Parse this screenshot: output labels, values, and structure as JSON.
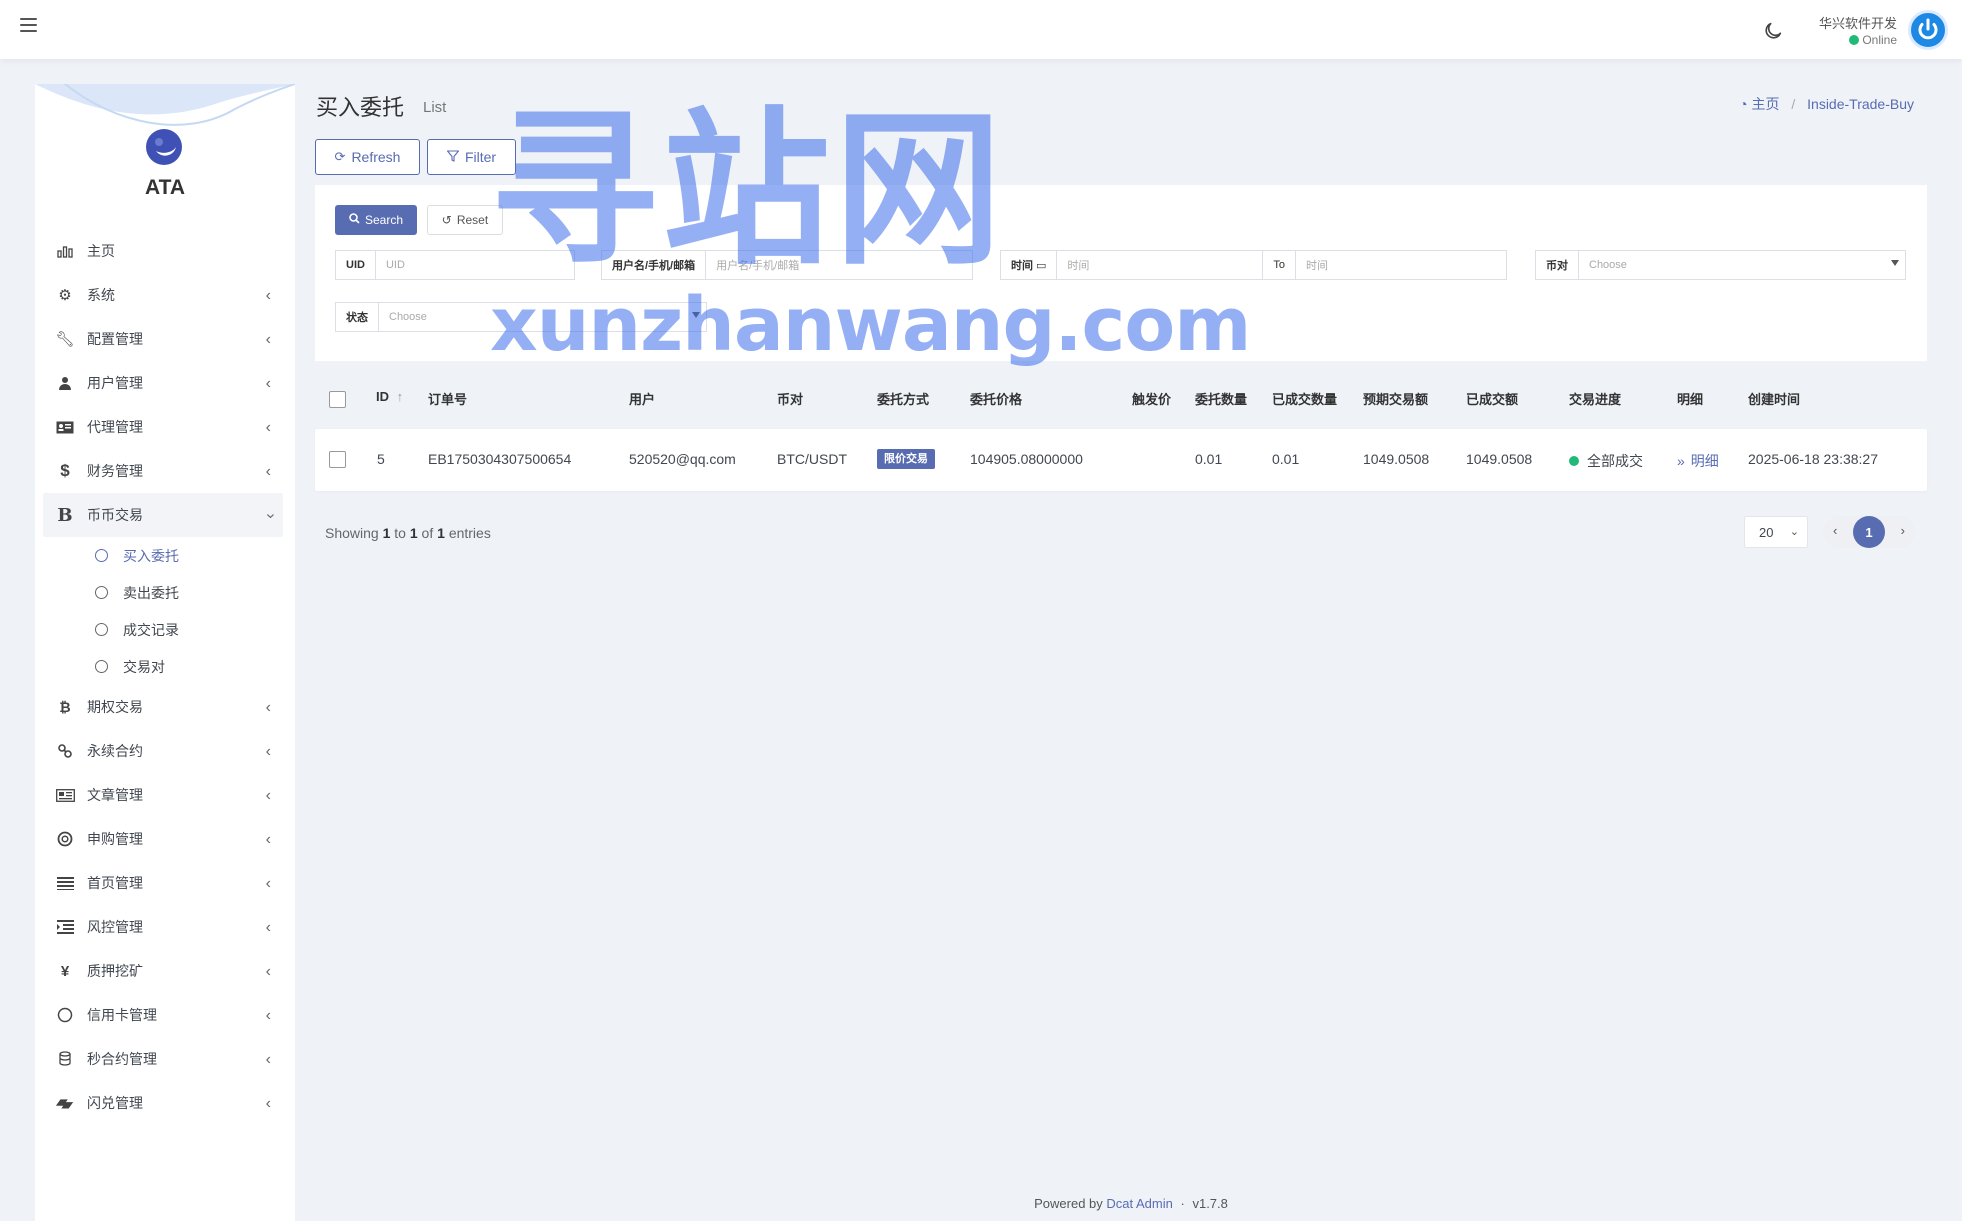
{
  "header": {
    "user_name": "华兴软件开发",
    "user_status": "Online"
  },
  "sidebar": {
    "brand": "ATA",
    "items": [
      {
        "label": "主页",
        "icon": "bar-chart-icon"
      },
      {
        "label": "系统",
        "icon": "gear-icon"
      },
      {
        "label": "配置管理",
        "icon": "wrench-icon"
      },
      {
        "label": "用户管理",
        "icon": "users-icon"
      },
      {
        "label": "代理管理",
        "icon": "id-card-icon"
      },
      {
        "label": "财务管理",
        "icon": "dollar-icon"
      },
      {
        "label": "币币交易",
        "icon": "bitcoin-b-icon"
      },
      {
        "label": "期权交易",
        "icon": "bitcoin-icon"
      },
      {
        "label": "永续合约",
        "icon": "link-icon"
      },
      {
        "label": "文章管理",
        "icon": "newspaper-icon"
      },
      {
        "label": "申购管理",
        "icon": "lifebuoy-icon"
      },
      {
        "label": "首页管理",
        "icon": "list-icon"
      },
      {
        "label": "风控管理",
        "icon": "indent-icon"
      },
      {
        "label": "质押挖矿",
        "icon": "yen-icon"
      },
      {
        "label": "信用卡管理",
        "icon": "circle-icon"
      },
      {
        "label": "秒合约管理",
        "icon": "coins-icon"
      },
      {
        "label": "闪兑管理",
        "icon": "exchange-icon"
      }
    ],
    "submenu": [
      {
        "label": "买入委托"
      },
      {
        "label": "卖出委托"
      },
      {
        "label": "成交记录"
      },
      {
        "label": "交易对"
      }
    ]
  },
  "page": {
    "title": "买入委托",
    "subtitle": "List",
    "breadcrumb_home": "主页",
    "breadcrumb_current": "Inside-Trade-Buy"
  },
  "toolbar": {
    "refresh_label": "Refresh",
    "filter_label": "Filter"
  },
  "filter": {
    "search_label": "Search",
    "reset_label": "Reset",
    "uid_label": "UID",
    "uid_placeholder": "UID",
    "user_label": "用户名/手机/邮箱",
    "user_placeholder": "用户名/手机/邮箱",
    "time_label": "时间",
    "time_placeholder": "时间",
    "to_label": "To",
    "to_placeholder": "时间",
    "pair_label": "币对",
    "pair_value": "Choose",
    "status_label": "状态",
    "status_value": "Choose"
  },
  "table": {
    "columns": {
      "id": "ID",
      "order_no": "订单号",
      "user": "用户",
      "pair": "币对",
      "method": "委托方式",
      "price": "委托价格",
      "trigger": "触发价",
      "qty": "委托数量",
      "filled_qty": "已成交数量",
      "expected": "预期交易额",
      "filled_amt": "已成交额",
      "progress": "交易进度",
      "detail": "明细",
      "created": "创建时间"
    },
    "rows": [
      {
        "id": "5",
        "order_no": "EB1750304307500654",
        "user": "520520@qq.com",
        "pair": "BTC/USDT",
        "method": "限价交易",
        "price": "104905.08000000",
        "trigger": "",
        "qty": "0.01",
        "filled_qty": "0.01",
        "expected": "1049.0508",
        "filled_amt": "1049.0508",
        "progress": "全部成交",
        "progress_color": "#21b978",
        "detail": "明细",
        "created": "2025-06-18 23:38:27"
      }
    ]
  },
  "pagination": {
    "showing_prefix": "Showing",
    "from": "1",
    "to_word": "to",
    "to": "1",
    "of_word": "of",
    "total": "1",
    "entries_word": "entries",
    "per_page": "20",
    "current_page": "1"
  },
  "footer": {
    "powered_by": "Powered by",
    "link": "Dcat Admin",
    "dot": "·",
    "version": "v1.7.8"
  },
  "watermark": {
    "line1": "寻站网",
    "line2": "xunzhanwang.com"
  },
  "colors": {
    "primary": "#586cb1",
    "success": "#21b978",
    "background": "#eff3f8"
  }
}
